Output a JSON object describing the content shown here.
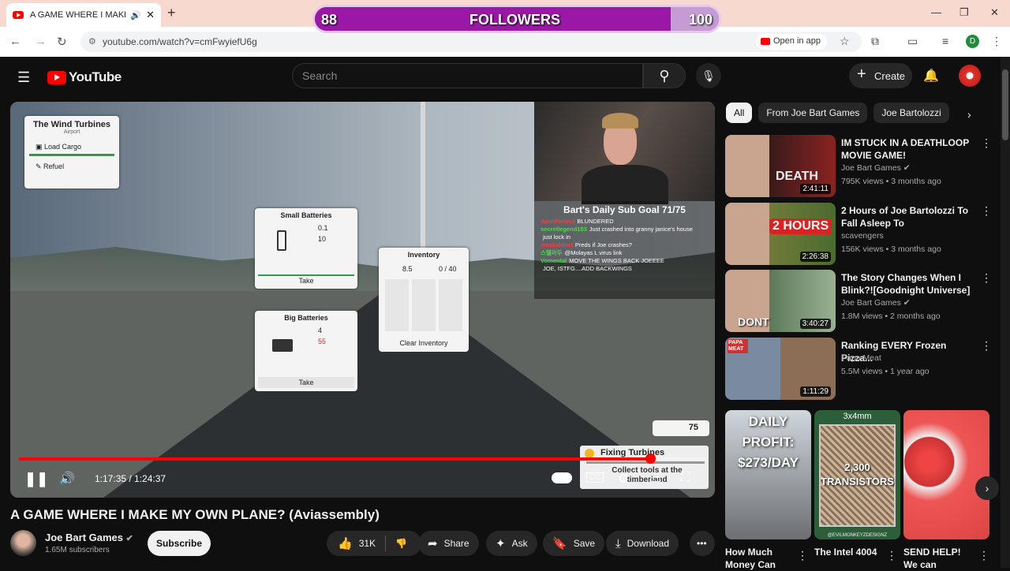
{
  "browser": {
    "tab_title": "A GAME WHERE I MAKE MY",
    "tab_audio": "🔊",
    "tab_close": "✕",
    "new_tab": "+",
    "url": "youtube.com/watch?v=cmFwyiefU6g",
    "open_in_app": "Open in app",
    "profile_letter": "D",
    "minimize": "—",
    "restore": "❐",
    "close": "✕"
  },
  "overlay": {
    "followers_label": "FOLLOWERS",
    "followers_current": "88",
    "followers_goal": "100",
    "followers_progress": 0.88
  },
  "youtube": {
    "logo_text": "YouTube",
    "search_placeholder": "Search",
    "create_label": "Create"
  },
  "player": {
    "time": "1:17:35 / 1:24:37",
    "progress": 0.917,
    "game": {
      "location_title": "The Wind Turbines",
      "location_sub": "Airport",
      "load_cargo": "Load Cargo",
      "refuel": "Refuel",
      "small_batteries_title": "Small Batteries",
      "small_batteries_val1": "0.1",
      "small_batteries_val2": "10",
      "small_take": "Take",
      "big_batteries_title": "Big Batteries",
      "big_batteries_val1": "4",
      "big_batteries_val2": "55",
      "big_take": "Take",
      "inventory_title": "Inventory",
      "inventory_weight": "8.5",
      "inventory_capacity": "0 / 40",
      "clear_inventory": "Clear Inventory",
      "coins": "75",
      "quest_title": "Fixing Turbines",
      "quest_desc": "Collect tools at the timberland"
    },
    "stream": {
      "goal": "Bart's Daily Sub Goal 71/75",
      "chat": [
        {
          "user": "JunnPerfect",
          "msg": "BLUNDERED",
          "color": "#e84545"
        },
        {
          "user": "secretlegend153",
          "msg": "Just crashed into granny janice's house",
          "color": "#4fd84f"
        },
        {
          "user": "",
          "msg": "just lock in",
          "color": "#ffffff"
        },
        {
          "user": "ikeakabinet",
          "msg": "Preds if Joe crashes?",
          "color": "#e84545"
        },
        {
          "user": "스텔라두",
          "msg": "@Molayas L virus link",
          "color": "#4fd84f"
        },
        {
          "user": "Vomental",
          "msg": "MOVE THE WINGS BACK JOEEEE",
          "color": "#4fd84f"
        },
        {
          "user": "",
          "msg": "JOE, ISTFG....ADD BACKWINGS",
          "color": "#ffffff"
        }
      ]
    }
  },
  "video": {
    "title": "A GAME WHERE I MAKE MY OWN PLANE? (Aviassembly)",
    "channel": "Joe Bart Games",
    "subscribers": "1.65M subscribers",
    "subscribe_label": "Subscribe",
    "likes": "31K",
    "share_label": "Share",
    "ask_label": "Ask",
    "save_label": "Save",
    "download_label": "Download"
  },
  "chips": [
    "All",
    "From Joe Bart Games",
    "Joe Bartolozzi"
  ],
  "recommendations": [
    {
      "title": "IM STUCK IN A DEATHLOOP MOVIE GAME!",
      "channel": "Joe Bart Games",
      "verified": true,
      "meta": "795K views • 3 months ago",
      "duration": "2:41:11",
      "thumb_text": "DEATH"
    },
    {
      "title": "2 Hours of Joe Bartolozzi To Fall Asleep To",
      "channel": "scavengers",
      "verified": false,
      "meta": "156K views • 3 months ago",
      "duration": "2:26:38",
      "thumb_text": "2 HOURS"
    },
    {
      "title": "The Story Changes When I Blink?![Goodnight Universe]",
      "channel": "Joe Bart Games",
      "verified": true,
      "meta": "1.8M views • 2 months ago",
      "duration": "3:40:27",
      "thumb_text": "DONT"
    },
    {
      "title": "Ranking EVERY Frozen Pizza...",
      "channel": "Papa Meat",
      "verified": false,
      "meta": "5.5M views • 1 year ago",
      "duration": "1:11:29",
      "thumb_text": "PAPA MEAT"
    }
  ],
  "shorts": [
    {
      "title": "How Much Money Can",
      "thumb_text": "DAILY PROFIT: $273/DAY"
    },
    {
      "title": "The Intel 4004",
      "thumb_text": "2,300 TRANSISTORS",
      "top_text": "3x4mm",
      "watermark": "@EVILMONKEYZDESIGNZ"
    },
    {
      "title": "SEND HELP! We can",
      "thumb_text": ""
    }
  ]
}
